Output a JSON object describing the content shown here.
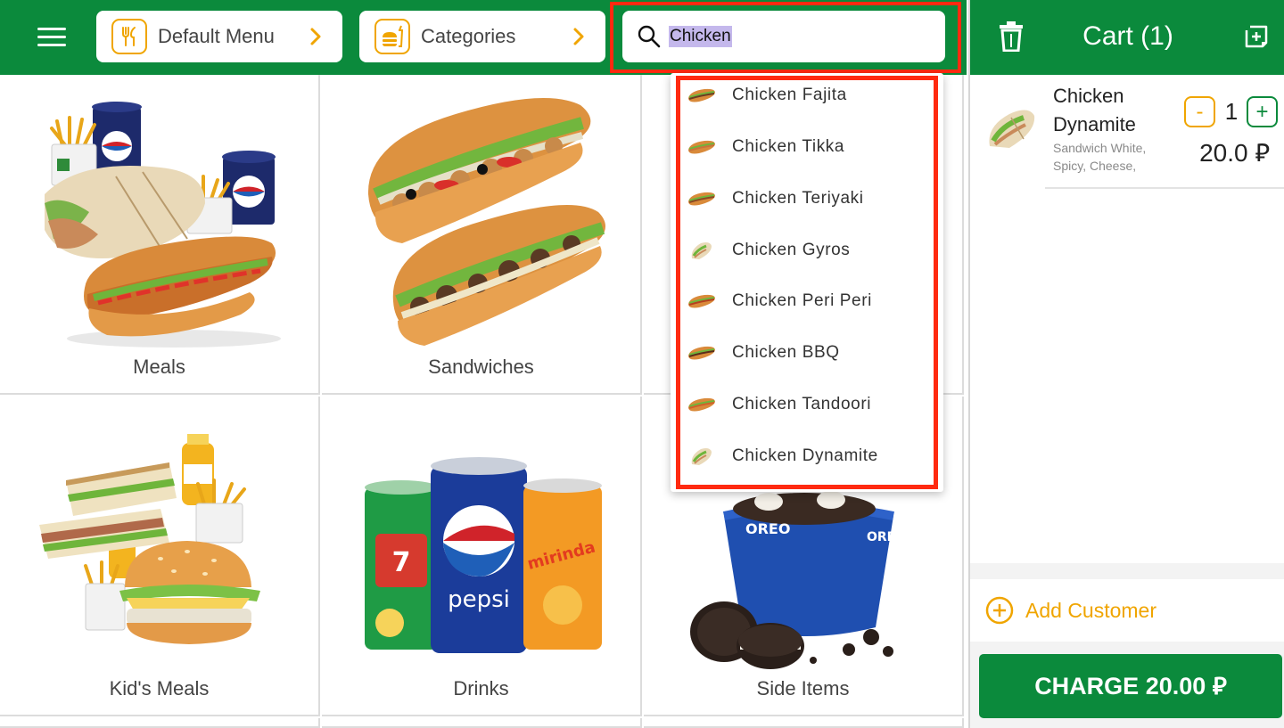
{
  "toolbar": {
    "menu_icon": "hamburger-icon",
    "menu_selector_label": "Default Menu",
    "categories_label": "Categories",
    "search": {
      "value": "Chicken",
      "placeholder": ""
    }
  },
  "categories": [
    {
      "label": "Meals",
      "icon": "meal-image"
    },
    {
      "label": "Sandwiches",
      "icon": "sandwich-image"
    },
    {
      "label": "",
      "icon": ""
    },
    {
      "label": "Kid's Meals",
      "icon": "kids-meal-image"
    },
    {
      "label": "Drinks",
      "icon": "drinks-image"
    },
    {
      "label": "Side Items",
      "icon": "oreo-dessert-image"
    }
  ],
  "search_results": [
    {
      "label": "Chicken Fajita",
      "icon": "sub-sandwich-thumb"
    },
    {
      "label": "Chicken Tikka",
      "icon": "sub-sandwich-thumb"
    },
    {
      "label": "Chicken Teriyaki",
      "icon": "sub-sandwich-thumb"
    },
    {
      "label": "Chicken Gyros",
      "icon": "wrap-thumb"
    },
    {
      "label": "Chicken Peri Peri",
      "icon": "sub-sandwich-thumb"
    },
    {
      "label": "Chicken BBQ",
      "icon": "sub-sandwich-thumb"
    },
    {
      "label": "Chicken Tandoori",
      "icon": "sub-sandwich-thumb"
    },
    {
      "label": "Chicken Dynamite",
      "icon": "wrap-thumb"
    }
  ],
  "cart": {
    "title": "Cart (1)",
    "items": [
      {
        "name": "Chicken Dynamite",
        "modifiers": "Sandwich White, Spicy, Cheese,",
        "quantity": "1",
        "price": "20.0 ⃁",
        "minus": "-",
        "plus": "+"
      }
    ],
    "add_customer_label": "Add Customer",
    "charge_label": "CHARGE 20.00 ⃁"
  },
  "colors": {
    "brand_green": "#0b8a3c",
    "accent_orange": "#f0a500",
    "highlight_red": "#ff2a10"
  }
}
